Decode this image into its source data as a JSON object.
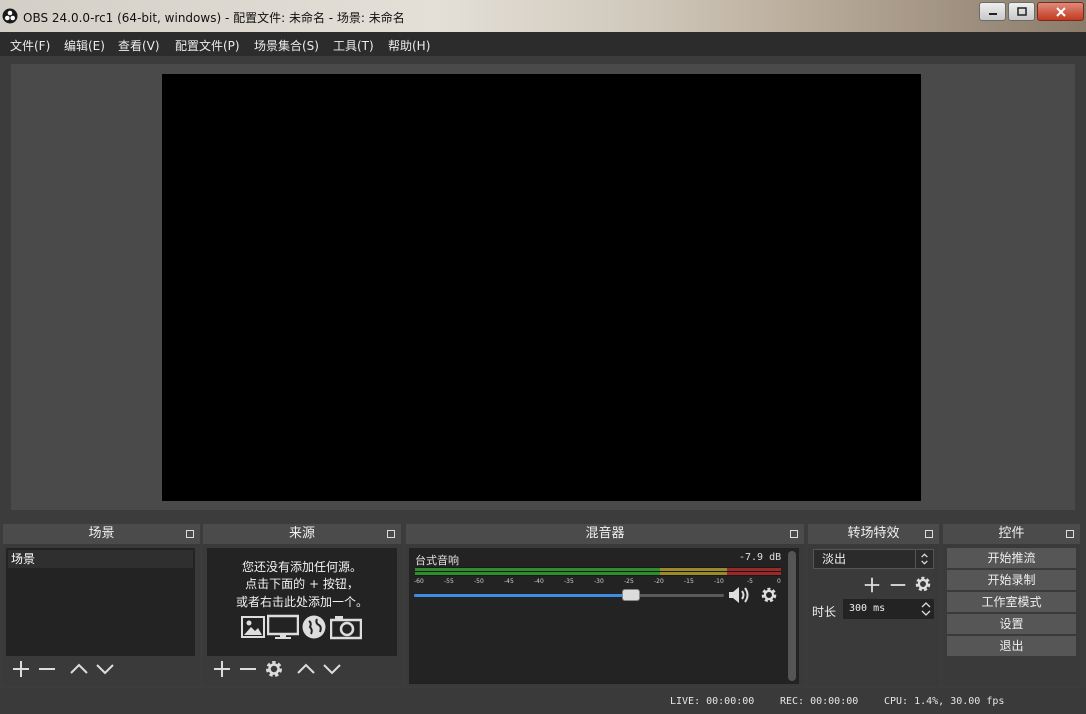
{
  "window": {
    "title": "OBS 24.0.0-rc1 (64-bit, windows) - 配置文件: 未命名 - 场景: 未命名"
  },
  "menu": [
    {
      "label": "文件(F)"
    },
    {
      "label": "编辑(E)"
    },
    {
      "label": "查看(V)"
    },
    {
      "label": "配置文件(P)"
    },
    {
      "label": "场景集合(S)"
    },
    {
      "label": "工具(T)"
    },
    {
      "label": "帮助(H)"
    }
  ],
  "scenes": {
    "title": "场景",
    "items": [
      "场景"
    ]
  },
  "sources": {
    "title": "来源",
    "empty_line1": "您还没有添加任何源。",
    "empty_line2": "点击下面的 + 按钮，",
    "empty_line3": "或者右击此处添加一个。"
  },
  "mixer": {
    "title": "混音器",
    "channel_name": "台式音响",
    "db_value": "-7.9 dB",
    "fader_level": 0.7,
    "tick_labels": [
      "-60",
      "-55",
      "-50",
      "-45",
      "-40",
      "-35",
      "-30",
      "-25",
      "-20",
      "-15",
      "-10",
      "-5",
      "0"
    ]
  },
  "transitions": {
    "title": "转场特效",
    "selected": "淡出",
    "duration_label": "时长",
    "duration_value": "300 ms"
  },
  "controls": {
    "title": "控件",
    "buttons": [
      "开始推流",
      "开始录制",
      "工作室模式",
      "设置",
      "退出"
    ]
  },
  "status": {
    "live": "LIVE: 00:00:00",
    "rec": "REC: 00:00:00",
    "cpu": "CPU: 1.4%, 30.00 fps"
  },
  "colors": {
    "accent": "#3c8ee5",
    "meter_green": "#2f8f2f",
    "meter_yellow": "#9a8a2a",
    "meter_red": "#9a2a2a"
  },
  "icons": [
    "obs-logo-icon",
    "minimize-icon",
    "maximize-icon",
    "close-icon",
    "plus-icon",
    "minus-icon",
    "up-icon",
    "down-icon",
    "gear-icon",
    "image-icon",
    "display-icon",
    "globe-icon",
    "camera-icon",
    "speaker-icon"
  ]
}
